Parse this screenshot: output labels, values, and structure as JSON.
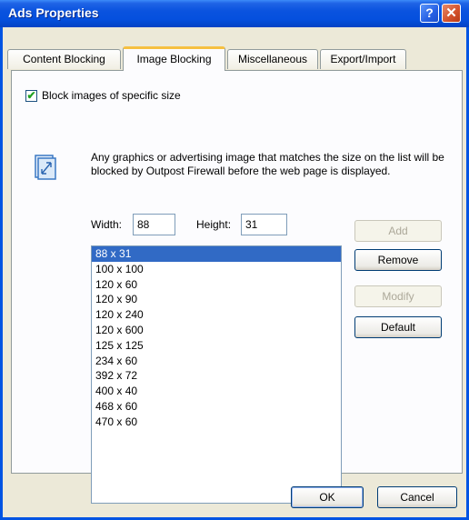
{
  "window": {
    "title": "Ads Properties",
    "help_glyph": "?",
    "close_glyph": "✕"
  },
  "tabs": [
    {
      "label": "Content Blocking",
      "active": false
    },
    {
      "label": "Image Blocking",
      "active": true
    },
    {
      "label": "Miscellaneous",
      "active": false
    },
    {
      "label": "Export/Import",
      "active": false
    }
  ],
  "image_blocking": {
    "checkbox_label": "Block images of specific size",
    "checkbox_checked": true,
    "info_text": "Any graphics or advertising image that matches the size on the list will be blocked by Outpost Firewall before the web page is displayed.",
    "width_label": "Width:",
    "width_value": "88",
    "height_label": "Height:",
    "height_value": "31",
    "sizes": [
      "88 x 31",
      "100 x 100",
      "120 x 60",
      "120 x 90",
      "120 x 240",
      "120 x 600",
      "125 x 125",
      "234 x 60",
      "392 x 72",
      "400 x 40",
      "468 x 60",
      "470 x 60"
    ],
    "selected_index": 0,
    "buttons": {
      "add": "Add",
      "remove": "Remove",
      "modify": "Modify",
      "default": "Default"
    }
  },
  "dialog_buttons": {
    "ok": "OK",
    "cancel": "Cancel"
  },
  "icons": {
    "info": "resize-image-icon",
    "check": "checkmark-icon"
  }
}
